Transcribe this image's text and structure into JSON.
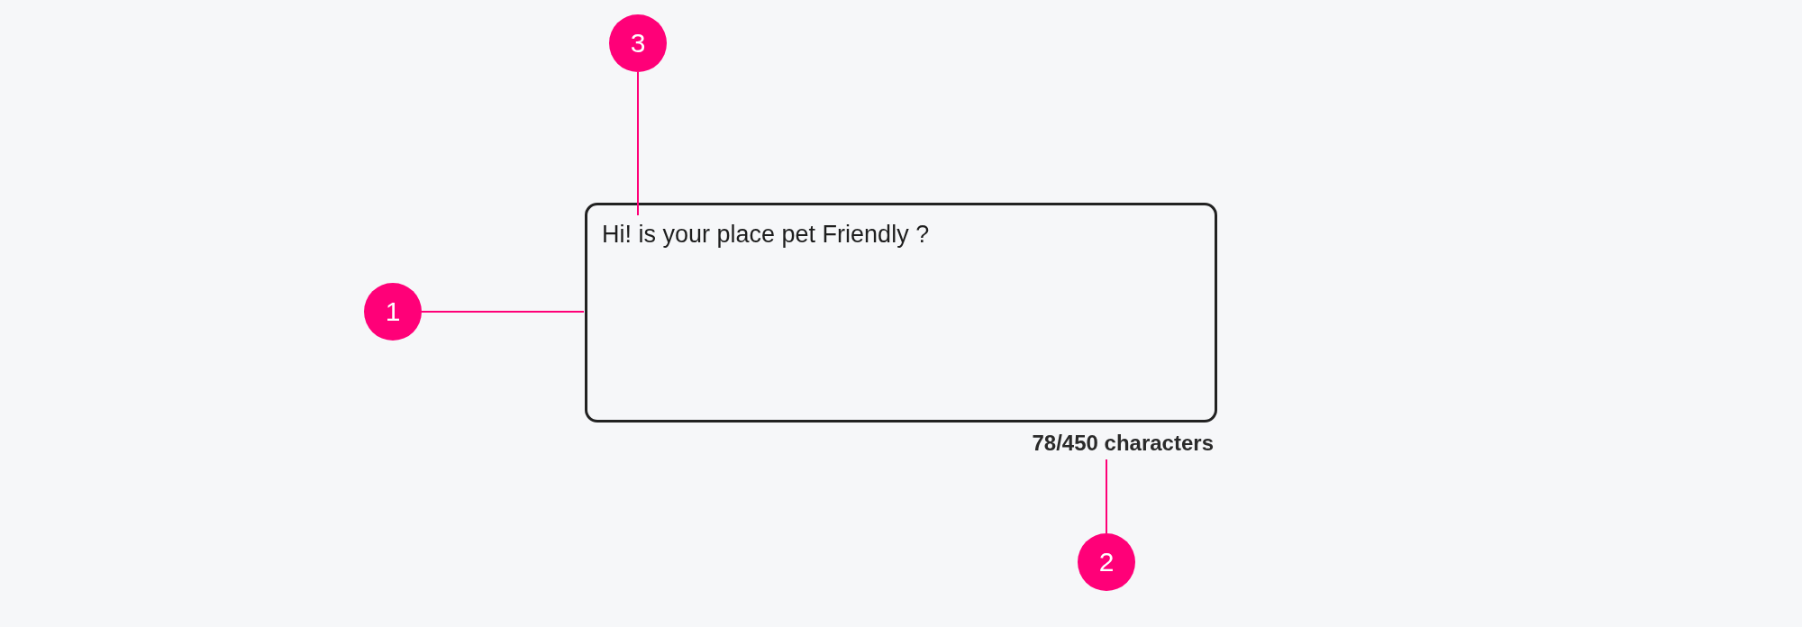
{
  "field": {
    "value": "Hi! is your place pet Friendly ?",
    "counter": "78/450 characters"
  },
  "callouts": [
    {
      "number": "3",
      "kind": "text"
    },
    {
      "number": "1",
      "kind": "container"
    },
    {
      "number": "2",
      "kind": "counter"
    }
  ]
}
